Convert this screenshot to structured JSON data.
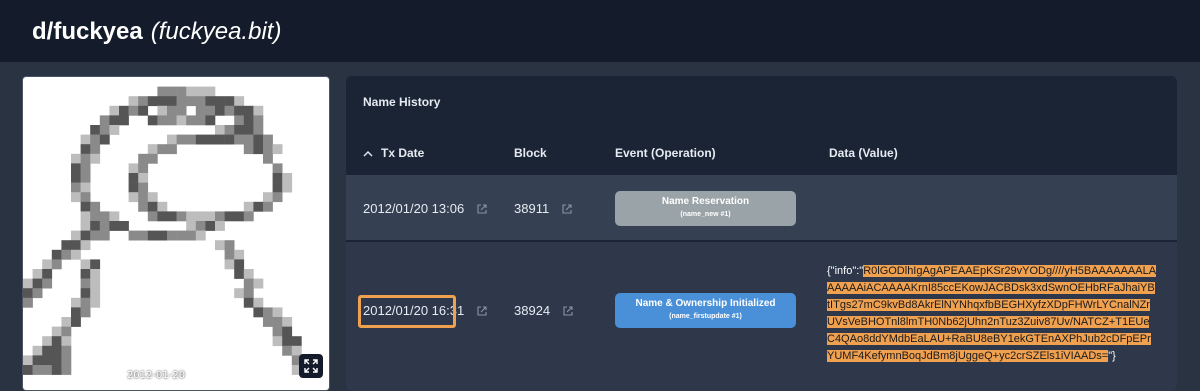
{
  "header": {
    "name": "d/fuckyea",
    "domain": "(fuckyea.bit)"
  },
  "image": {
    "caption": "2012-01-20",
    "expand_icon": "expand-icon"
  },
  "history": {
    "title": "Name History",
    "columns": {
      "tx_date": "Tx Date",
      "block": "Block",
      "event": "Event (Operation)",
      "data": "Data (Value)"
    },
    "rows": [
      {
        "date": "2012/01/20 13:06",
        "block": "38911",
        "event_title": "Name Reservation",
        "event_sub": "(name_new #1)",
        "event_color": "#9aa3a7",
        "data_prefix": "",
        "data_highlight": "",
        "data_suffix": ""
      },
      {
        "date": "2012/01/20 16:31",
        "block": "38924",
        "event_title": "Name & Ownership Initialized",
        "event_sub": "(name_firstupdate #1)",
        "event_color": "#4a90d9",
        "data_prefix": "{\"info\":\"",
        "data_highlight": "R0lGODlhIgAgAPEAAEpKSr29vYODg////yH5BAAAAAAALAAAAAAiACAAAAKrnI85ccEKowJACBDsk3xdSwnOEHbRFaJhaiYBtITgs27mC9kvBd8AkrElNYNhqxfbBEGHXyfzXDpFHWrLYCnalNZrUVsVeBHOTnl8lmTH0Nb62jUhn2nTuz3Zuiv87Uv/NATCZ+T1EUeC4QAo8ddYMdbEaLAU+RaBU8eBY1ekGTEnAXPhJub2cDFpEPrYUMF4KefymnBoqJdBm8jUggeQ+yc2crSZEls1iVIAADs=",
        "data_suffix": "\"}"
      }
    ]
  },
  "colors": {
    "header_bg": "#141c2b",
    "page_bg": "#2a3342",
    "table_bg": "#1b2434",
    "highlight": "#f0a150"
  }
}
